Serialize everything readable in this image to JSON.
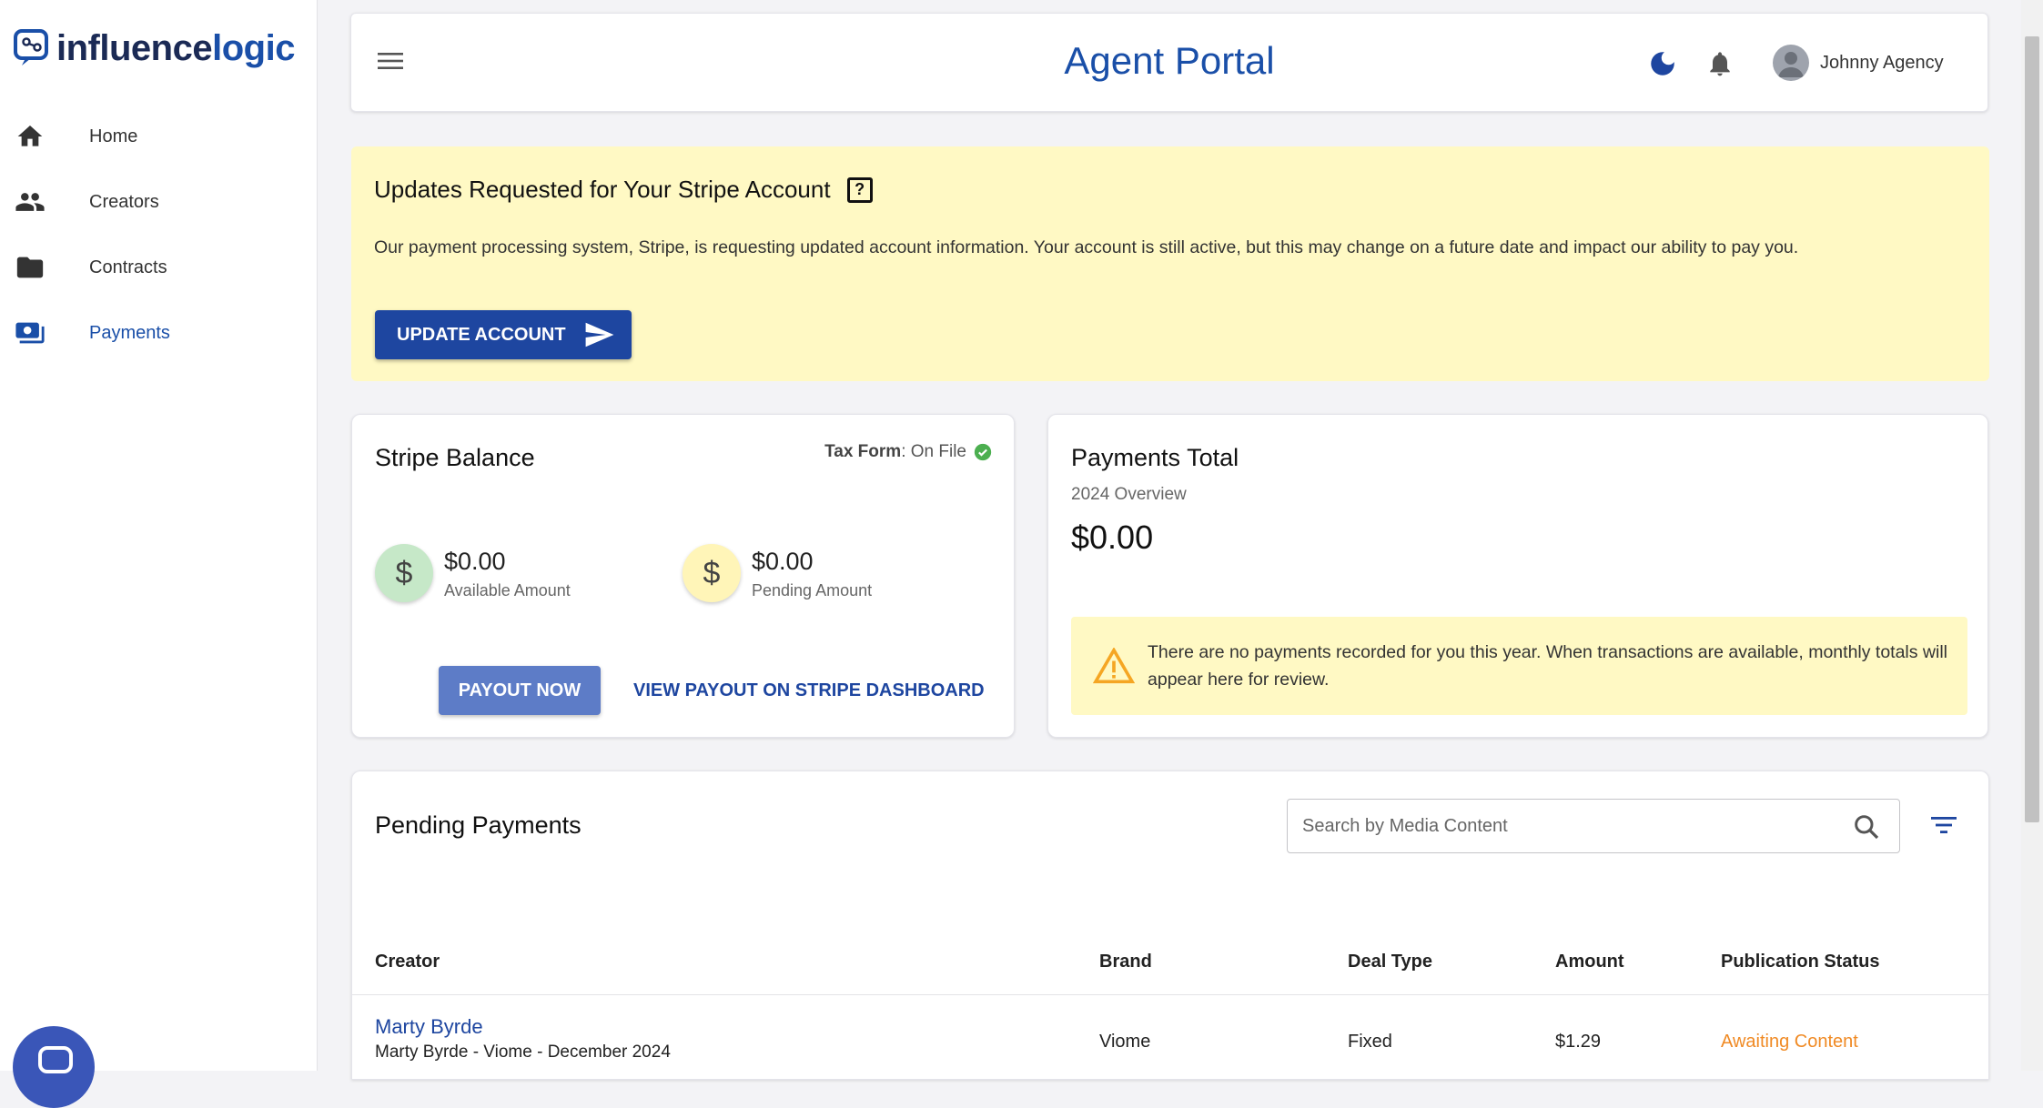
{
  "brand": {
    "name_part1": "influence",
    "name_part2": "logic"
  },
  "sidebar": {
    "items": [
      {
        "label": "Home",
        "icon": "home-icon"
      },
      {
        "label": "Creators",
        "icon": "people-icon"
      },
      {
        "label": "Contracts",
        "icon": "folder-icon"
      },
      {
        "label": "Payments",
        "icon": "payments-icon",
        "active": true
      }
    ]
  },
  "header": {
    "title": "Agent Portal",
    "user_name": "Johnny Agency"
  },
  "banner": {
    "title": "Updates Requested for Your Stripe Account",
    "help_glyph": "?",
    "text": "Our payment processing system, Stripe, is requesting updated account information. Your account is still active, but this may change on a future date and impact our ability to pay you.",
    "button_label": "UPDATE ACCOUNT"
  },
  "stripe_balance": {
    "title": "Stripe Balance",
    "tax_form_label": "Tax Form",
    "tax_form_status": ": On File",
    "available_amount": "$0.00",
    "available_label": "Available Amount",
    "pending_amount": "$0.00",
    "pending_label": "Pending Amount",
    "dollar_glyph": "$",
    "payout_button": "PAYOUT NOW",
    "stripe_link": "VIEW PAYOUT ON STRIPE DASHBOARD"
  },
  "payments_total": {
    "title": "Payments Total",
    "subtitle": "2024 Overview",
    "total": "$0.00",
    "notice": "There are no payments recorded for you this year. When transactions are available, monthly totals will appear here for review."
  },
  "pending_payments": {
    "title": "Pending Payments",
    "search_placeholder": "Search by Media Content",
    "columns": [
      "Creator",
      "Brand",
      "Deal Type",
      "Amount",
      "Publication Status"
    ],
    "rows": [
      {
        "creator": "Marty Byrde",
        "description": "Marty Byrde - Viome - December 2024",
        "brand": "Viome",
        "deal_type": "Fixed",
        "amount": "$1.29",
        "status": "Awaiting Content"
      }
    ]
  },
  "colors": {
    "primary": "#1e46a0",
    "banner_bg": "#fff9c4",
    "status_awaiting": "#f08a24",
    "success": "#4caf50"
  }
}
